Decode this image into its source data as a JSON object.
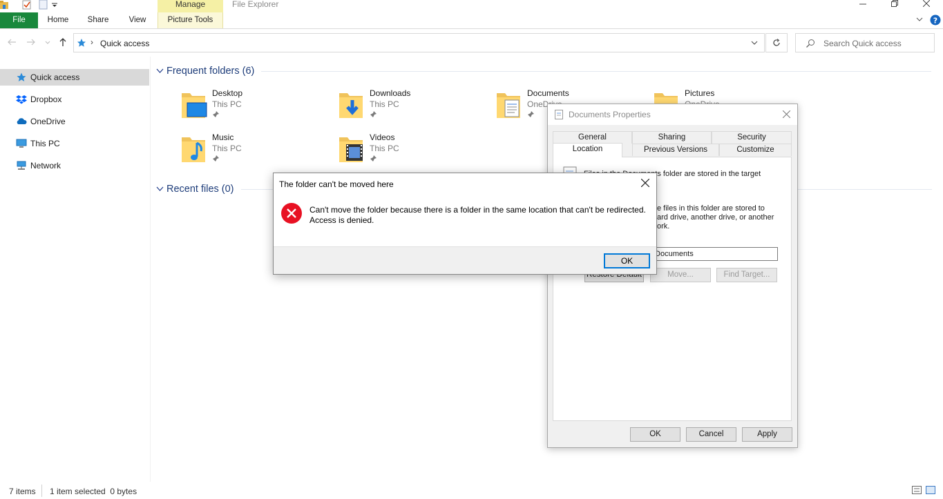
{
  "window": {
    "title": "File Explorer",
    "manage_label": "Manage",
    "accent_color": "#19883c",
    "controls": [
      "minimize-icon",
      "restore-icon",
      "close-icon"
    ]
  },
  "ribbon": {
    "tabs": [
      "File",
      "Home",
      "Share",
      "View",
      "Picture Tools"
    ]
  },
  "address": {
    "path": "Quick access",
    "search_placeholder": "Search Quick access"
  },
  "nav_pane": {
    "items": [
      {
        "label": "Quick access",
        "icon": "star-icon"
      },
      {
        "label": "Dropbox",
        "icon": "dropbox-icon"
      },
      {
        "label": "OneDrive",
        "icon": "cloud-icon"
      },
      {
        "label": "This PC",
        "icon": "computer-icon"
      },
      {
        "label": "Network",
        "icon": "network-icon"
      }
    ]
  },
  "content": {
    "frequent_header": "Frequent folders (6)",
    "recent_header": "Recent files (0)",
    "folders": [
      {
        "name": "Desktop",
        "location": "This PC",
        "overlay": "desktop"
      },
      {
        "name": "Downloads",
        "location": "This PC",
        "overlay": "download-arrow"
      },
      {
        "name": "Documents",
        "location": "OneDrive",
        "overlay": "document"
      },
      {
        "name": "Pictures",
        "location": "OneDrive",
        "overlay": "none"
      },
      {
        "name": "Music",
        "location": "This PC",
        "overlay": "music-note"
      },
      {
        "name": "Videos",
        "location": "This PC",
        "overlay": "film"
      }
    ]
  },
  "status_bar": {
    "items_count": "7 items",
    "selection": "1 item selected  0 bytes"
  },
  "properties_dialog": {
    "title": "Documents Properties",
    "tabs_row1": [
      "General",
      "Sharing",
      "Security"
    ],
    "tabs_row2": [
      "Location",
      "Previous Versions",
      "Customize"
    ],
    "active_tab": "Location",
    "text1": "Files in the Documents folder are stored in the target",
    "text2_lines": [
      "e files in this folder are stored to",
      "ard drive, another drive, or another",
      "ork."
    ],
    "path_value": "\\Documents",
    "buttons_row": [
      "Restore Default",
      "Move...",
      "Find Target..."
    ],
    "footer_buttons": [
      "OK",
      "Cancel",
      "Apply"
    ]
  },
  "error_dialog": {
    "title": "The folder can't be moved here",
    "message": "Can't move the folder because there is a folder in the same location that can't be redirected. Access is denied.",
    "ok_label": "OK",
    "icon": "error-icon",
    "icon_color": "#e81123"
  }
}
